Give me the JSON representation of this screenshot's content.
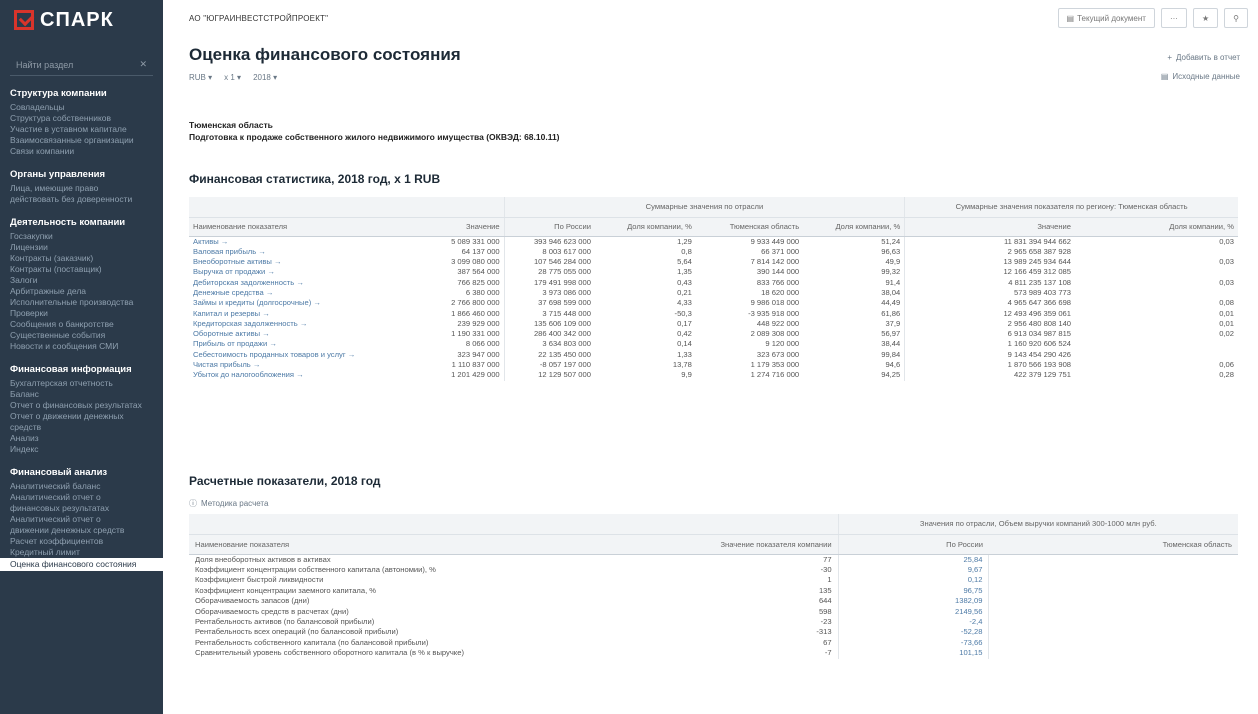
{
  "brand": {
    "name": "СПАРК",
    "accent": "#d9342b",
    "sidebar_bg": "#2b3a4a"
  },
  "sidebar": {
    "search_placeholder": "Найти раздел",
    "sections": [
      {
        "title": "Структура компании",
        "items": [
          "Совладельцы",
          "Структура собственников",
          "Участие в уставном капитале",
          "Взаимосвязанные организации",
          "Связи компании"
        ]
      },
      {
        "title": "Органы управления",
        "items": [
          "Лица, имеющие право",
          "действовать без доверенности"
        ]
      },
      {
        "title": "Деятельность компании",
        "items": [
          "Госзакупки",
          "Лицензии",
          "Контракты (заказчик)",
          "Контракты (поставщик)",
          "Залоги",
          "Арбитражные дела",
          "Исполнительные производства",
          "Проверки",
          "Сообщения о банкротстве",
          "Существенные события",
          "Новости и сообщения СМИ"
        ]
      },
      {
        "title": "Финансовая информация",
        "items": [
          "Бухгалтерская отчетность",
          "Баланс",
          "Отчет о финансовых результатах",
          "Отчет о движении денежных",
          "средств",
          "Анализ",
          "Индекс"
        ]
      },
      {
        "title": "Финансовый анализ",
        "items": [
          "Аналитический баланс",
          "Аналитический отчет о",
          "финансовых результатах",
          "Аналитический отчет о",
          "движении денежных средств",
          "Расчет коэффициентов",
          "Кредитный лимит",
          "Оценка финансового состояния"
        ]
      }
    ],
    "active_item": "Оценка финансового состояния"
  },
  "header": {
    "company": "АО \"ЮГРАИНВЕСТСТРОЙПРОЕКТ\"",
    "btn_current_report": "Текущий документ",
    "btn_more": "···",
    "btn_star": "★",
    "btn_pin": "⚲"
  },
  "page": {
    "title": "Оценка финансового состояния",
    "filters": [
      "RUB ▾",
      "x 1 ▾",
      "2018 ▾"
    ],
    "add_to_report": "Добавить в отчет",
    "source_data": "Исходные данные",
    "region": "Тюменская область",
    "okved": "Подготовка к продаже собственного жилого недвижимого имущества (ОКВЭД: 68.10.11)"
  },
  "stats": {
    "title": "Финансовая статистика, 2018 год, x 1 RUB",
    "group1": "Суммарные значения по отрасли",
    "group2": "Суммарные значения показателя по региону: Тюменская область",
    "columns": [
      "Наименование показателя",
      "Значение",
      "По России",
      "Доля компании, %",
      "Тюменская область",
      "Доля компании, %",
      "Значение",
      "Доля компании, %"
    ],
    "rows": [
      [
        "Активы →",
        "5 089 331 000",
        "393 946 623 000",
        "1,29",
        "9 933 449 000",
        "51,24",
        "11 831 394 944 662",
        "0,03"
      ],
      [
        "Валовая прибыль →",
        "64 137 000",
        "8 003 617 000",
        "0,8",
        "66 371 000",
        "96,63",
        "2 965 658 387 928",
        ""
      ],
      [
        "Внеоборотные активы →",
        "3 099 080 000",
        "107 546 284 000",
        "5,64",
        "7 814 142 000",
        "49,9",
        "13 989 245 934 644",
        "0,03"
      ],
      [
        "Выручка от продажи →",
        "387 564 000",
        "28 775 055 000",
        "1,35",
        "390 144 000",
        "99,32",
        "12 166 459 312 085",
        ""
      ],
      [
        "Дебиторская задолженность →",
        "766 825 000",
        "179 491 998 000",
        "0,43",
        "833 766 000",
        "91,4",
        "4 811 235 137 108",
        "0,03"
      ],
      [
        "Денежные средства →",
        "6 380 000",
        "3 973 086 000",
        "0,21",
        "18 620 000",
        "38,04",
        "573 989 403 773",
        ""
      ],
      [
        "Займы и кредиты (долгосрочные) →",
        "2 766 800 000",
        "37 698 599 000",
        "4,33",
        "9 986 018 000",
        "44,49",
        "4 965 647 366 698",
        "0,08"
      ],
      [
        "Капитал и резервы →",
        "1 866 460 000",
        "3 715 448 000",
        "-50,3",
        "-3 935 918 000",
        "61,86",
        "12 493 496 359 061",
        "0,01"
      ],
      [
        "Кредиторская задолженность →",
        "239 929 000",
        "135 606 109 000",
        "0,17",
        "448 922 000",
        "37,9",
        "2 956 480 808 140",
        "0,01"
      ],
      [
        "Оборотные активы →",
        "1 190 331 000",
        "286 400 342 000",
        "0,42",
        "2 089 308 000",
        "56,97",
        "6 913 034 987 815",
        "0,02"
      ],
      [
        "Прибыль от продажи →",
        "8 066 000",
        "3 634 803 000",
        "0,14",
        "9 120 000",
        "38,44",
        "1 160 920 606 524",
        ""
      ],
      [
        "Себестоимость проданных товаров и услуг →",
        "323 947 000",
        "22 135 450 000",
        "1,33",
        "323 673 000",
        "99,84",
        "9 143 454 290 426",
        ""
      ],
      [
        "Чистая прибыль →",
        "1 110 837 000",
        "-8 057 197 000",
        "13,78",
        "1 179 353 000",
        "94,6",
        "1 870 566 193 908",
        "0,06"
      ],
      [
        "Убыток до налогообложения →",
        "1 201 429 000",
        "12 129 507 000",
        "9,9",
        "1 274 716 000",
        "94,25",
        "422 379 129 751",
        "0,28"
      ]
    ]
  },
  "calc": {
    "title": "Расчетные показатели, 2018 год",
    "method": "Методика расчета",
    "group": "Значения по отрасли, Объем выручки компаний 300-1000 млн руб.",
    "columns": [
      "Наименование показателя",
      "Значение показателя компании",
      "По России",
      "Тюменская область"
    ],
    "rows": [
      [
        "Доля внеоборотных активов в активах",
        "77",
        "25,84",
        ""
      ],
      [
        "Коэффициент концентрации собственного капитала (автономии), %",
        "-30",
        "9,67",
        ""
      ],
      [
        "Коэффициент быстрой ликвидности",
        "1",
        "0,12",
        ""
      ],
      [
        "Коэффициент концентрации заемного капитала, %",
        "135",
        "96,75",
        ""
      ],
      [
        "Оборачиваемость запасов (дни)",
        "644",
        "1382,09",
        ""
      ],
      [
        "Оборачиваемость средств в расчетах (дни)",
        "598",
        "2149,56",
        ""
      ],
      [
        "Рентабельность активов (по балансовой прибыли)",
        "-23",
        "-2,4",
        ""
      ],
      [
        "Рентабельность всех операций (по балансовой прибыли)",
        "-313",
        "-52,28",
        ""
      ],
      [
        "Рентабельность собственного капитала (по балансовой прибыли)",
        "67",
        "-73,66",
        ""
      ],
      [
        "Сравнительный уровень собственного оборотного капитала (в % к выручке)",
        "-7",
        "101,15",
        ""
      ]
    ]
  }
}
